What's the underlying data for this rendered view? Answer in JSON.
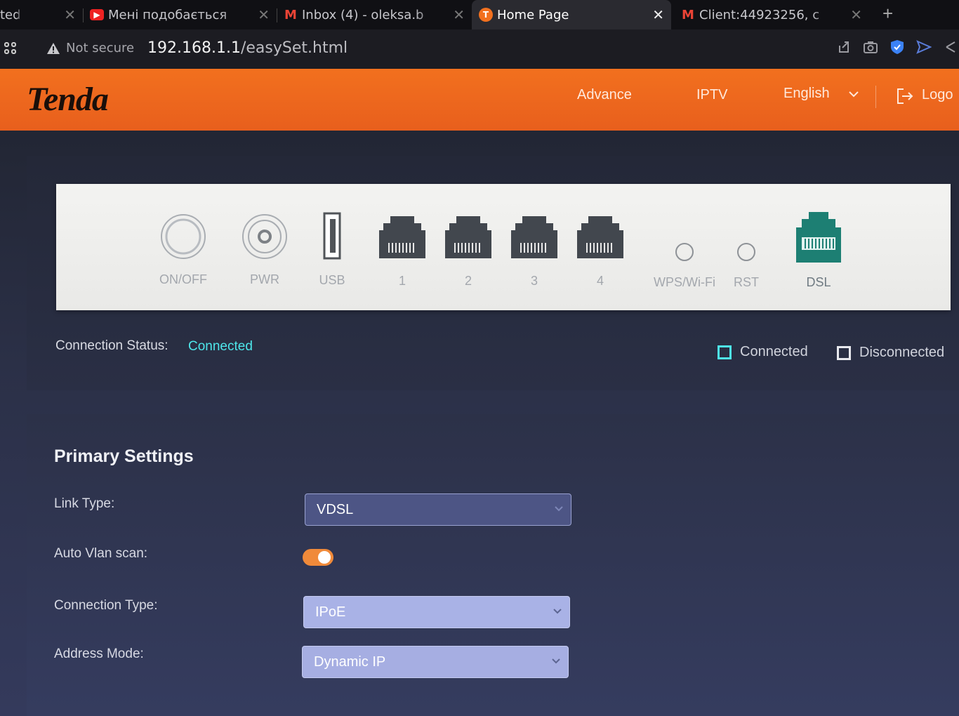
{
  "browser": {
    "tabs": [
      {
        "title": "ted",
        "favicon": "none"
      },
      {
        "title": "Мені подобається",
        "favicon": "youtube-icon"
      },
      {
        "title": "Inbox (4) - oleksa.b",
        "favicon": "gmail-icon"
      },
      {
        "title": "Home Page",
        "favicon": "tenda-icon"
      },
      {
        "title": "Client:44923256, c",
        "favicon": "gmail-icon"
      }
    ],
    "active_tab_index": 3,
    "security_label": "Not secure",
    "url_host": "192.168.1.1",
    "url_path": "/easySet.html"
  },
  "header": {
    "logo": "Tenda",
    "nav": {
      "advance": "Advance",
      "iptv": "IPTV",
      "language": "English",
      "logout": "Logo"
    }
  },
  "device_panel": {
    "ports": [
      {
        "label": "ON/OFF",
        "icon": "power-button-icon"
      },
      {
        "label": "PWR",
        "icon": "power-jack-icon"
      },
      {
        "label": "USB",
        "icon": "usb-port-icon"
      },
      {
        "label": "1",
        "icon": "lan-port-icon"
      },
      {
        "label": "2",
        "icon": "lan-port-icon"
      },
      {
        "label": "3",
        "icon": "lan-port-icon"
      },
      {
        "label": "4",
        "icon": "lan-port-icon"
      },
      {
        "label": "WPS/Wi-Fi",
        "icon": "button-icon"
      },
      {
        "label": "RST",
        "icon": "button-icon"
      },
      {
        "label": "DSL",
        "icon": "dsl-port-icon"
      }
    ]
  },
  "status": {
    "label": "Connection Status:",
    "value": "Connected",
    "legend_connected": "Connected",
    "legend_disconnected": "Disconnected"
  },
  "primary_settings": {
    "title": "Primary Settings",
    "link_type_label": "Link Type:",
    "link_type_value": "VDSL",
    "auto_vlan_label": "Auto Vlan scan:",
    "auto_vlan_enabled": true,
    "connection_type_label": "Connection Type:",
    "connection_type_value": "IPoE",
    "address_mode_label": "Address Mode:",
    "address_mode_value": "Dynamic IP"
  },
  "colors": {
    "brand_orange": "#f2701e",
    "connected_cyan": "#4ee6ea",
    "dsl_port_green": "#1d7f73",
    "toggle_on": "#f08a3a"
  }
}
